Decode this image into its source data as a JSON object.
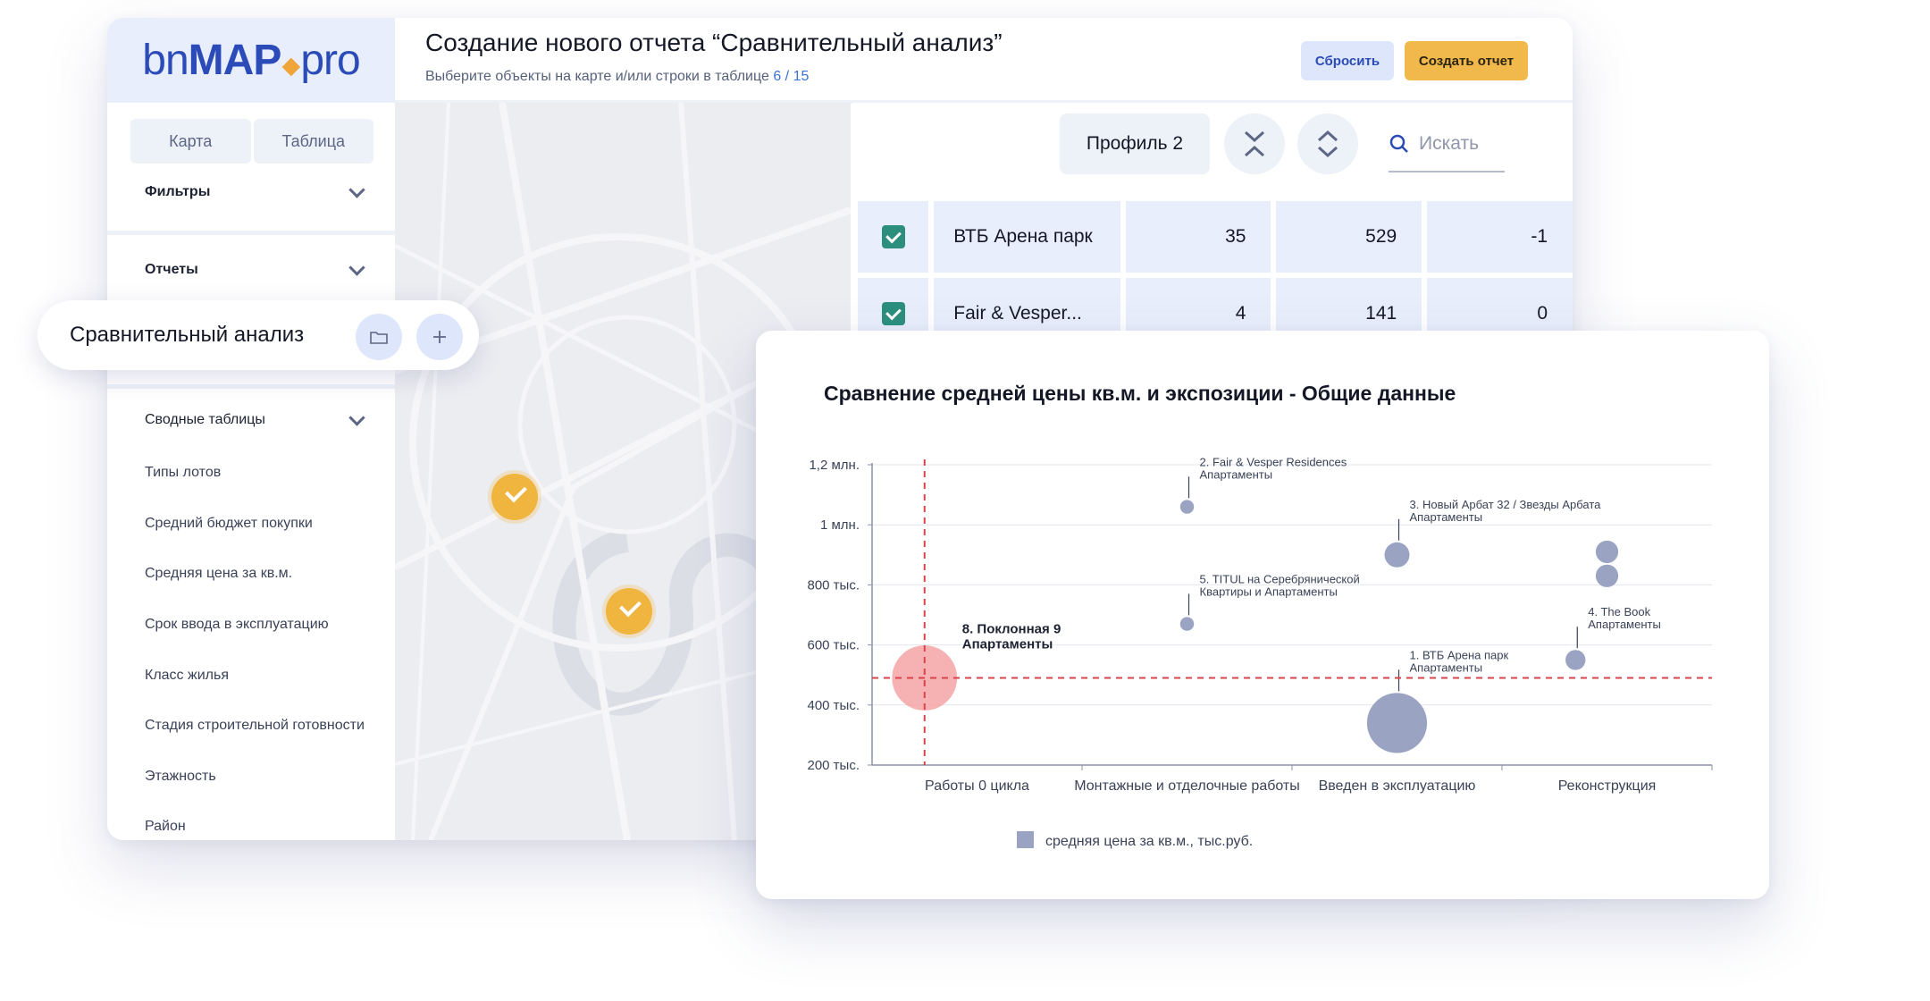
{
  "app": {
    "logo": {
      "part1": "bn",
      "part2": "MAP",
      "part3": "pro"
    },
    "header": {
      "title": "Создание нового отчета “Сравнительный анализ”",
      "subtitle": "Выберите объекты на карте и/или строки в таблице",
      "selected_count": "6 / 15",
      "reset_label": "Сбросить",
      "create_label": "Создать отчет"
    },
    "sidebar": {
      "tabs": [
        {
          "label": "Карта"
        },
        {
          "label": "Таблица"
        }
      ],
      "filters_label": "Фильтры",
      "reports_label": "Отчеты",
      "active_report": "Сравнительный анализ",
      "pivot_label": "Сводные таблицы",
      "items": [
        {
          "label": "Типы лотов"
        },
        {
          "label": "Средний бюджет покупки"
        },
        {
          "label": "Средняя цена за кв.м."
        },
        {
          "label": "Срок ввода в эксплуатацию"
        },
        {
          "label": "Класс жилья"
        },
        {
          "label": "Стадия строительной готовности"
        },
        {
          "label": "Этажность"
        },
        {
          "label": "Район"
        }
      ]
    },
    "table": {
      "profile_label": "Профиль 2",
      "search_placeholder": "Искать",
      "rows": [
        {
          "checked": true,
          "name": "ВТБ Арена парк",
          "c1": "35",
          "c2": "529",
          "c3": "-1"
        },
        {
          "checked": true,
          "name": "Fair & Vesper...",
          "c1": "4",
          "c2": "141",
          "c3": "0"
        }
      ]
    },
    "map": {
      "marker_color": "#f0b53f",
      "markers": 4
    }
  },
  "colors": {
    "brand": "#2b4bb8",
    "accent": "#f1b94c",
    "check": "#2c8f7d",
    "bubble": "#9aa3c2",
    "highlight": "#f4a4a4",
    "refline": "#d9434b"
  },
  "chart_data": {
    "type": "scatter",
    "title": "Сравнение средней цены кв.м. и экспозиции - Общие данные",
    "categories": [
      "Работы 0 цикла",
      "Монтажные и отделочные работы",
      "Введен в эксплуатацию",
      "Реконструкция"
    ],
    "y_ticks": [
      "1,2 млн.",
      "1 млн.",
      "800 тыс.",
      "600 тыс.",
      "400 тыс.",
      "200 тыс."
    ],
    "y_tick_values": [
      1200000,
      1000000,
      800000,
      600000,
      400000,
      200000
    ],
    "ylim": [
      200000,
      1200000
    ],
    "legend": "средняя цена за кв.м., тыс.руб.",
    "reference_lines": {
      "x_category": "Работы 0 цикла",
      "y_value": 490000
    },
    "points": [
      {
        "category": "Работы 0 цикла",
        "pos": 0.05,
        "y": 490000,
        "size": 26,
        "highlight": true,
        "label1": "8. Поклонная 9",
        "label2": "Апартаменты"
      },
      {
        "category": "Монтажные и отделочные работы",
        "pos": 0.5,
        "y": 1060000,
        "size": 5.5,
        "label1": "2. Fair & Vesper Residences",
        "label2": "Апартаменты"
      },
      {
        "category": "Монтажные и отделочные работы",
        "pos": 0.5,
        "y": 670000,
        "size": 5.5,
        "label1": "5. TITUL на Серебрянической",
        "label2": "Квартиры и Апартаменты"
      },
      {
        "category": "Введен в эксплуатацию",
        "pos": 0.5,
        "y": 900000,
        "size": 10,
        "label1": "3. Новый Арбат 32 / Звезды Арбата",
        "label2": "Апартаменты"
      },
      {
        "category": "Введен в эксплуатацию",
        "pos": 0.5,
        "y": 340000,
        "size": 24,
        "label1": "1. ВТБ Арена парк",
        "label2": "Апартаменты"
      },
      {
        "category": "Реконструкция",
        "pos": 0.5,
        "y": 910000,
        "size": 9,
        "label1": "",
        "label2": ""
      },
      {
        "category": "Реконструкция",
        "pos": 0.5,
        "y": 830000,
        "size": 9,
        "label1": "",
        "label2": ""
      },
      {
        "category": "Реконструкция",
        "pos": 0.35,
        "y": 550000,
        "size": 8,
        "label1": "4. The Book",
        "label2": "Апартаменты"
      }
    ]
  }
}
